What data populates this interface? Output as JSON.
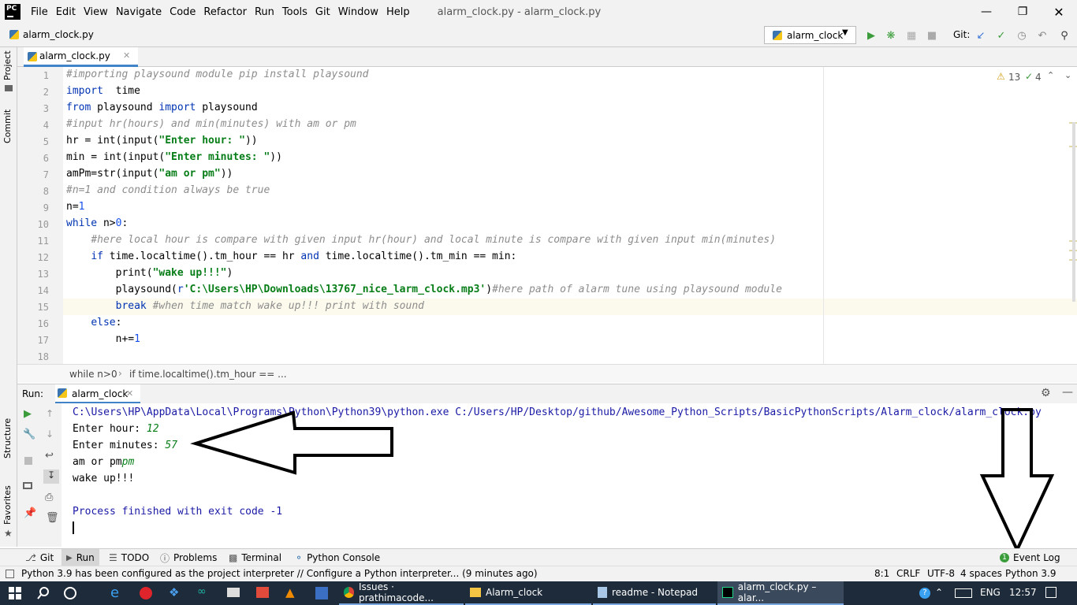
{
  "app": {
    "logo": "PC",
    "window_title": "alarm_clock.py - alarm_clock.py",
    "menu": [
      "File",
      "Edit",
      "View",
      "Navigate",
      "Code",
      "Refactor",
      "Run",
      "Tools",
      "Git",
      "Window",
      "Help"
    ]
  },
  "navbar": {
    "breadcrumb_file": "alarm_clock.py",
    "run_config": "alarm_clock",
    "git_label": "Git:"
  },
  "sidebar": {
    "project": "Project",
    "commit": "Commit",
    "structure": "Structure",
    "favorites": "Favorites"
  },
  "editor": {
    "tab_label": "alarm_clock.py",
    "warnings": "13",
    "checks": "4",
    "lines": [
      "1",
      "2",
      "3",
      "4",
      "5",
      "6",
      "7",
      "8",
      "9",
      "10",
      "11",
      "12",
      "13",
      "14",
      "15",
      "16",
      "17",
      "18"
    ]
  },
  "breadcrumbs": {
    "item1": "while n>0",
    "item2": "if time.localtime().tm_hour == ..."
  },
  "run_panel": {
    "label": "Run:",
    "tab": "alarm_clock",
    "cmd": "C:\\Users\\HP\\AppData\\Local\\Programs\\Python\\Python39\\python.exe C:/Users/HP/Desktop/github/Awesome_Python_Scripts/BasicPythonScripts/Alarm_clock/alarm_clock.py",
    "prompt_hour": "Enter hour: ",
    "val_hour": "12",
    "prompt_min": "Enter minutes: ",
    "val_min": "57",
    "prompt_ampm": "am or pm",
    "val_ampm": "pm",
    "wake": "wake up!!!",
    "finished": "Process finished with exit code -1"
  },
  "toolwindows": {
    "git": "Git",
    "run": "Run",
    "todo": "TODO",
    "problems": "Problems",
    "terminal": "Terminal",
    "console": "Python Console",
    "eventlog": "Event Log",
    "eventlog_count": "1"
  },
  "status": {
    "message": "Python 3.9 has been configured as the project interpreter // Configure a Python interpreter... (9 minutes ago)",
    "pos": "8:1",
    "crlf": "CRLF",
    "enc": "UTF-8",
    "indent": "4 spaces",
    "interp": "Python 3.9"
  },
  "taskbar": {
    "chrome": "Issues · prathimacode...",
    "explorer": "Alarm_clock",
    "notepad": "readme - Notepad",
    "pycharm": "alarm_clock.py – alar...",
    "lang": "ENG",
    "time": "12:57"
  },
  "colors": {
    "keyword": "#0033b3",
    "comment": "#8c8c8c",
    "string": "#067d17",
    "number": "#1750eb",
    "accent": "#4083c9",
    "taskbar": "#1e2b3a"
  }
}
